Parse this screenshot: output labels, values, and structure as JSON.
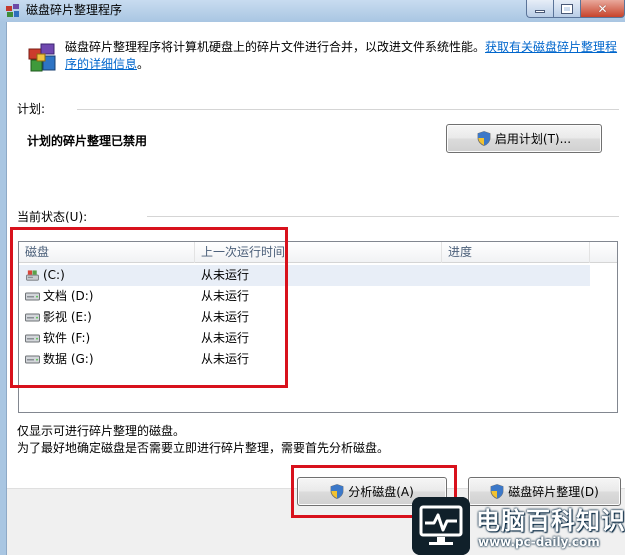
{
  "window": {
    "title": "磁盘碎片整理程序"
  },
  "description": {
    "text": "磁盘碎片整理程序将计算机硬盘上的碎片文件进行合并，以改进文件系统性能。",
    "link": "获取有关磁盘碎片整理程序的详细信息",
    "suffix": "。"
  },
  "schedule": {
    "label": "计划:",
    "status": "计划的碎片整理已禁用",
    "enable_button": "启用计划(T)..."
  },
  "current_status": {
    "label": "当前状态(U):",
    "columns": [
      "磁盘",
      "上一次运行时间",
      "进度"
    ],
    "rows": [
      {
        "disk": "(C:)",
        "last_run": "从未运行",
        "progress": "",
        "icon": "system-drive-icon"
      },
      {
        "disk": "文档 (D:)",
        "last_run": "从未运行",
        "progress": "",
        "icon": "drive-icon"
      },
      {
        "disk": "影视 (E:)",
        "last_run": "从未运行",
        "progress": "",
        "icon": "drive-icon"
      },
      {
        "disk": "软件 (F:)",
        "last_run": "从未运行",
        "progress": "",
        "icon": "drive-icon"
      },
      {
        "disk": "数据 (G:)",
        "last_run": "从未运行",
        "progress": "",
        "icon": "drive-icon"
      }
    ]
  },
  "notes": {
    "line1": "仅显示可进行碎片整理的磁盘。",
    "line2": "为了最好地确定磁盘是否需要立即进行碎片整理，需要首先分析磁盘。"
  },
  "buttons": {
    "analyze": "分析磁盘(A)",
    "defragment": "磁盘碎片整理(D)"
  },
  "watermark": {
    "title": "电脑百科知识",
    "url": "www.pc-daily.com"
  },
  "colors": {
    "highlight_box": "#d8111c",
    "link": "#0066cc",
    "selected_row": "#e8eef7"
  }
}
